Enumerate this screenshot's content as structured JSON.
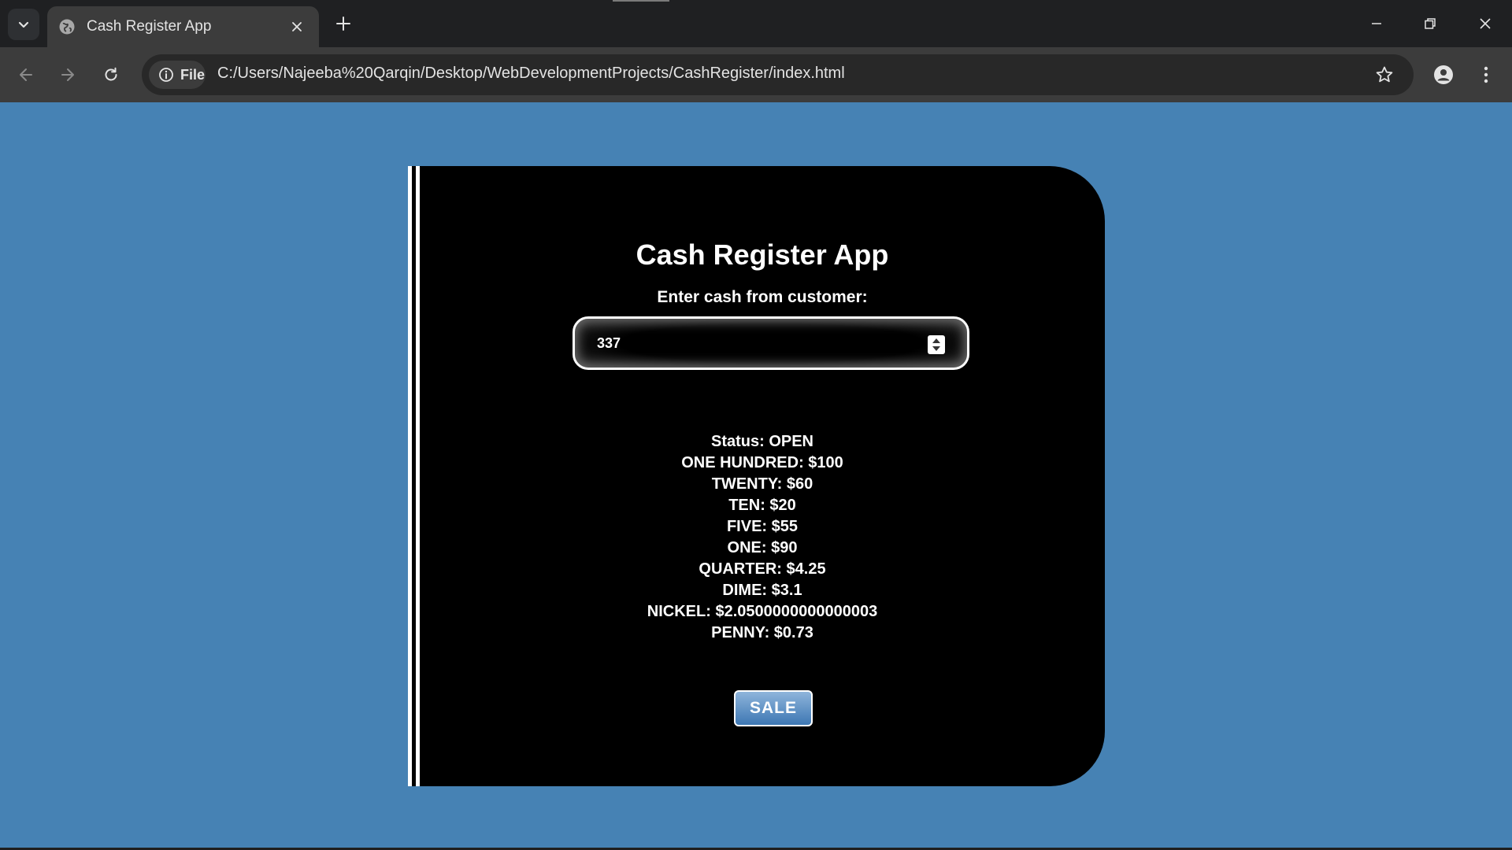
{
  "browser": {
    "tab_title": "Cash Register App",
    "site_chip_label": "File",
    "url": "C:/Users/Najeeba%20Qarqin/Desktop/WebDevelopmentProjects/CashRegister/index.html",
    "icons": {
      "tab_search": "chevron-down-icon",
      "favicon": "globe-icon",
      "tab_close": "close-icon",
      "new_tab": "plus-icon",
      "minimize": "minimize-icon",
      "restore": "restore-icon",
      "close": "close-icon",
      "back": "arrow-left-icon",
      "forward": "arrow-right-icon",
      "reload": "reload-icon",
      "info": "info-icon",
      "bookmark": "star-icon",
      "profile": "person-icon",
      "menu": "kebab-menu-icon"
    }
  },
  "app": {
    "title": "Cash Register App",
    "cash_label": "Enter cash from customer:",
    "cash_value": "337",
    "change_due": [
      "Status: OPEN",
      "ONE HUNDRED: $100",
      "TWENTY: $60",
      "TEN: $20",
      "FIVE: $55",
      "ONE: $90",
      "QUARTER: $4.25",
      "DIME: $3.1",
      "NICKEL: $2.0500000000000003",
      "PENNY: $0.73"
    ],
    "sale_button": "SALE"
  },
  "colors": {
    "page_background": "#4682b4",
    "register_background": "#000000",
    "text": "#ffffff",
    "chrome_dark": "#1f2022",
    "chrome_toolbar": "#3c3c3c"
  }
}
